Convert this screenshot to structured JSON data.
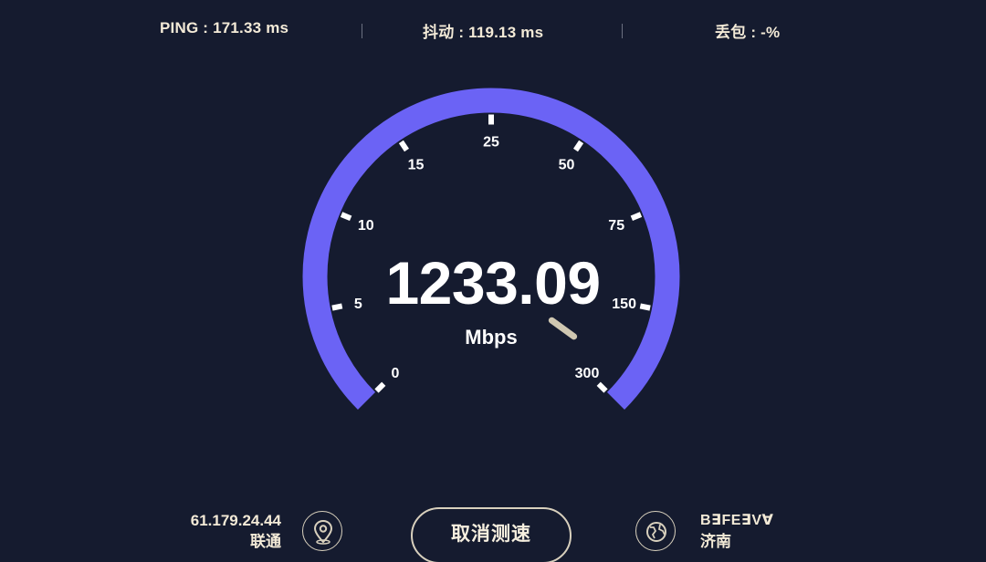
{
  "stats": {
    "ping": "PING : 171.33 ms",
    "jitter": "抖动 : 119.13 ms",
    "packet_loss": "丢包 : -%"
  },
  "gauge": {
    "speed": "1233.09",
    "unit": "Mbps",
    "ticks": [
      "0",
      "5",
      "10",
      "15",
      "25",
      "50",
      "75",
      "150",
      "300"
    ],
    "arc_color": "#6b63f5",
    "needle_color": "#f0e6c8"
  },
  "client": {
    "ip": "61.179.24.44",
    "isp": "联通",
    "icon": "location-pin-icon"
  },
  "actions": {
    "cancel_label": "取消测速"
  },
  "server": {
    "name": "B∃FE∃V∀",
    "isp": "济南",
    "icon": "server-globe-icon"
  },
  "colors": {
    "background": "#151b2f",
    "text": "#f3ead7"
  }
}
